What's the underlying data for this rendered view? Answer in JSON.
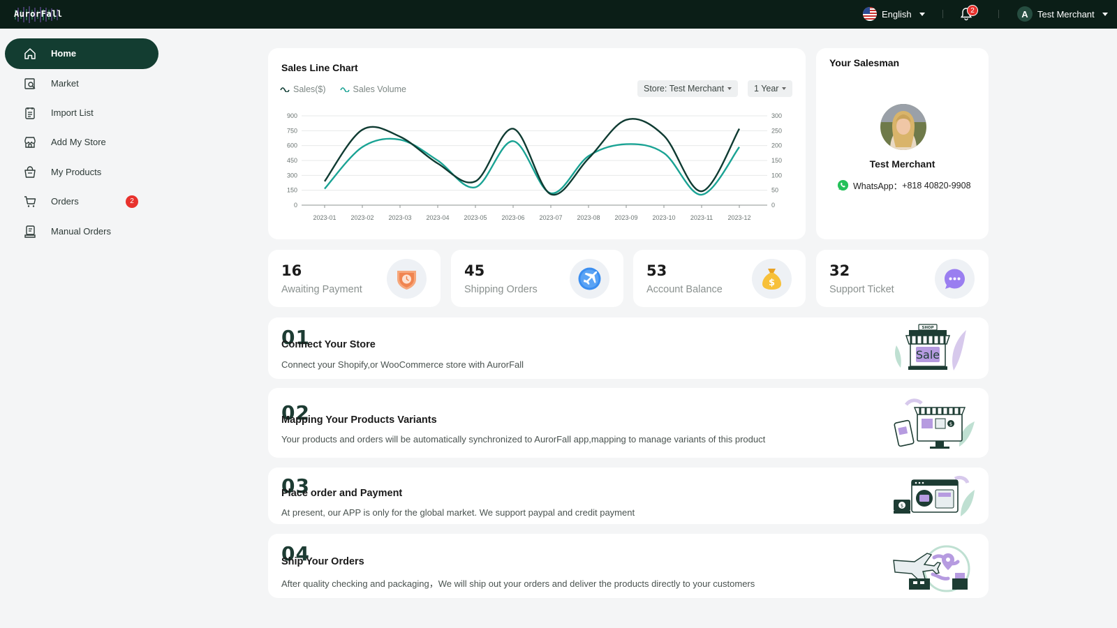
{
  "brand": {
    "logo_text": "AurorFall"
  },
  "header": {
    "language": "English",
    "notification_count": "2",
    "user_initial": "A",
    "user_name": "Test Merchant"
  },
  "sidebar": {
    "items": [
      {
        "label": "Home",
        "icon": "home-icon",
        "active": true
      },
      {
        "label": "Market",
        "icon": "market-search-icon"
      },
      {
        "label": "Import List",
        "icon": "list-icon"
      },
      {
        "label": "Add My Store",
        "icon": "store-icon"
      },
      {
        "label": "My Products",
        "icon": "basket-icon"
      },
      {
        "label": "Orders",
        "icon": "cart-icon",
        "badge": "2"
      },
      {
        "label": "Manual Orders",
        "icon": "manual-order-icon"
      }
    ]
  },
  "sales_chart": {
    "title": "Sales Line Chart",
    "store_filter": "Store: Test Merchant",
    "period_filter": "1 Year"
  },
  "chart_data": {
    "type": "line",
    "title": "Sales Line Chart",
    "categories": [
      "2023-01",
      "2023-02",
      "2023-03",
      "2023-04",
      "2023-05",
      "2023-06",
      "2023-07",
      "2023-08",
      "2023-09",
      "2023-10",
      "2023-11",
      "2023-12"
    ],
    "left_axis": {
      "ticks": [
        0,
        150,
        300,
        450,
        600,
        750,
        900
      ],
      "ylim": [
        0,
        900
      ]
    },
    "right_axis": {
      "ticks": [
        0,
        50,
        100,
        150,
        200,
        250,
        300
      ],
      "ylim": [
        0,
        300
      ]
    },
    "series": [
      {
        "name": "Sales($)",
        "axis": "left",
        "color": "#0f3b32",
        "values": [
          240,
          760,
          690,
          420,
          240,
          770,
          110,
          470,
          860,
          700,
          140,
          770
        ]
      },
      {
        "name": "Sales Volume",
        "axis": "right",
        "color": "#1aa394",
        "values": [
          55,
          195,
          220,
          150,
          60,
          215,
          40,
          165,
          205,
          175,
          35,
          195
        ]
      }
    ],
    "grid": true
  },
  "salesman": {
    "title": "Your Salesman",
    "name": "Test Merchant",
    "whatsapp_label": "WhatsApp：",
    "whatsapp_number": "+818  40820-9908"
  },
  "stats": [
    {
      "value": "16",
      "label": "Awaiting Payment",
      "icon": "clock-shield-icon"
    },
    {
      "value": "45",
      "label": "Shipping Orders",
      "icon": "airplane-icon"
    },
    {
      "value": "53",
      "label": "Account Balance",
      "icon": "money-bag-icon"
    },
    {
      "value": "32",
      "label": "Support Ticket",
      "icon": "chat-bubble-icon"
    }
  ],
  "steps": [
    {
      "num": "01",
      "title": "Connect Your Store",
      "desc": "Connect your Shopify,or WooCommerce store with AurorFall",
      "illus": "shop-sale-icon",
      "illus_text": "Sale",
      "illus_sign": "SHOP"
    },
    {
      "num": "02",
      "title": "Mapping Your Products Variants",
      "desc": "Your products and orders will be automatically synchronized to AurorFall app,mapping to manage variants of this product",
      "illus": "online-shop-icon"
    },
    {
      "num": "03",
      "title": "Place order and Payment",
      "desc": "At present, our APP is only for the global  market. We support paypal and credit payment",
      "illus": "payment-icon"
    },
    {
      "num": "04",
      "title": "Ship Your Orders",
      "desc": "After quality checking and packaging，We will ship out your orders and deliver the products directly to your customers",
      "illus": "shipping-globe-icon"
    }
  ]
}
